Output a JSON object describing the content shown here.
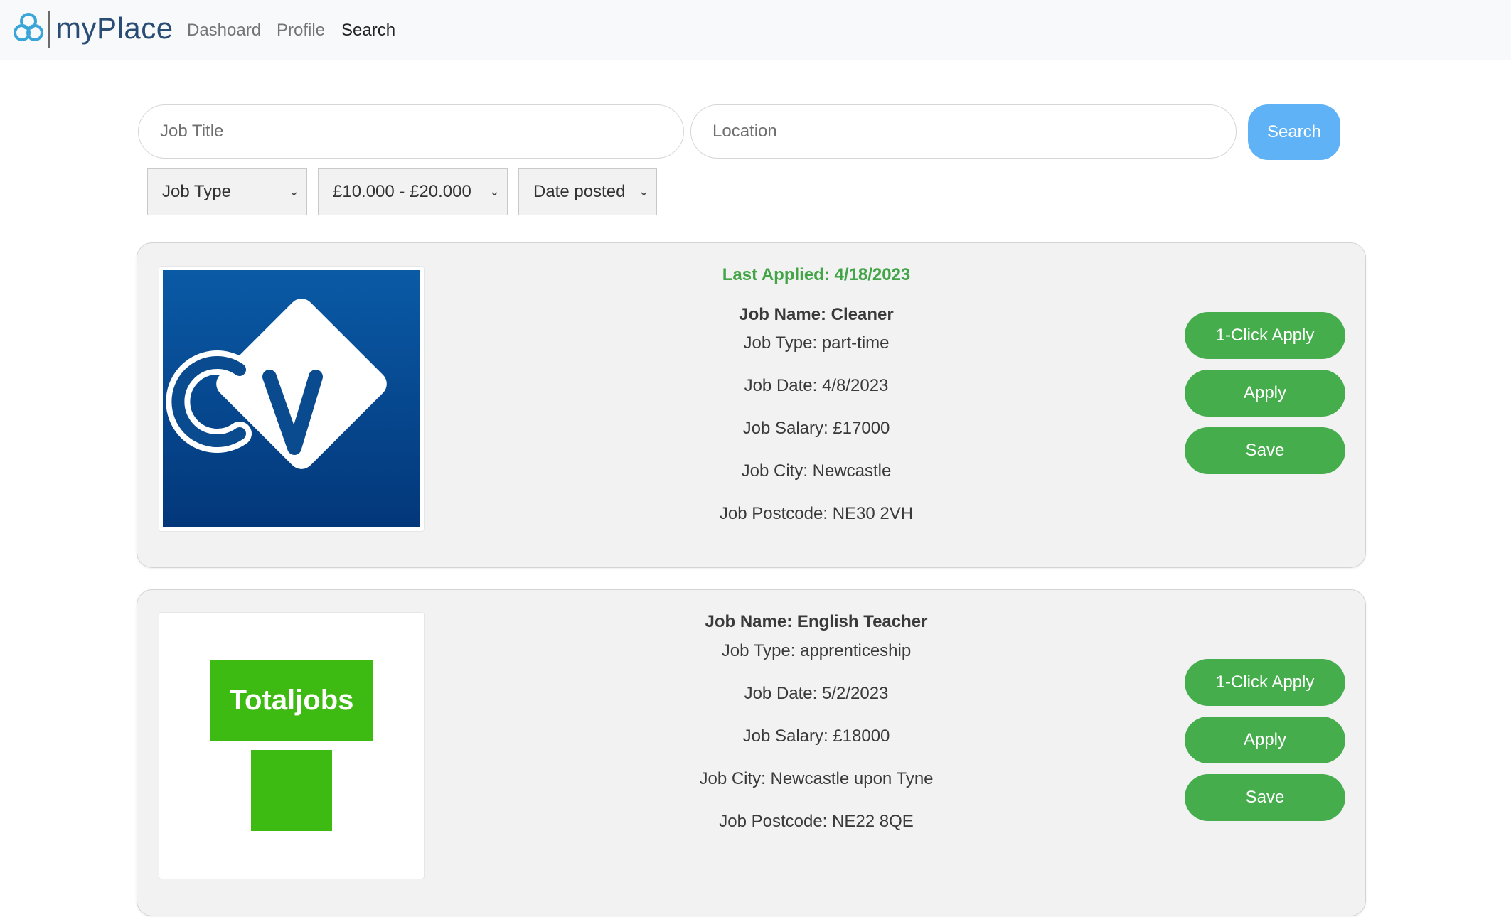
{
  "app": {
    "brand": "myPlace"
  },
  "nav": {
    "items": [
      "Dashoard",
      "Profile",
      "Search"
    ],
    "active": "Search"
  },
  "search": {
    "job_title_placeholder": "Job Title",
    "location_placeholder": "Location",
    "button_label": "Search"
  },
  "filters": {
    "job_type": "Job Type",
    "salary": "£10.000 - £20.000",
    "date_posted": "Date posted"
  },
  "jobs": [
    {
      "last_applied": "Last Applied: 4/18/2023",
      "name": "Job Name: Cleaner",
      "type": "Job Type: part-time",
      "date": "Job Date: 4/8/2023",
      "salary": "Job Salary: £17000",
      "city": "Job City: Newcastle",
      "postcode": "Job Postcode: NE30 2VH",
      "logo": "cv-logo",
      "buttons": {
        "one_click": "1-Click Apply",
        "apply": "Apply",
        "save": "Save"
      }
    },
    {
      "name": "Job Name: English Teacher",
      "type": "Job Type: apprenticeship",
      "date": "Job Date: 5/2/2023",
      "salary": "Job Salary: £18000",
      "city": "Job City: Newcastle upon Tyne",
      "postcode": "Job Postcode: NE22 8QE",
      "logo": "totaljobs-logo",
      "logo_text": "Totaljobs",
      "buttons": {
        "one_click": "1-Click Apply",
        "apply": "Apply",
        "save": "Save"
      }
    }
  ],
  "colors": {
    "navbar_bg": "#f8f9fa",
    "search_button": "#5eb2f5",
    "action_button": "#45ad4c",
    "applied_text": "#43a548",
    "card_bg": "#f2f2f2",
    "totaljobs_green": "#3dbb12",
    "cv_blue": "#0a4a8f"
  }
}
